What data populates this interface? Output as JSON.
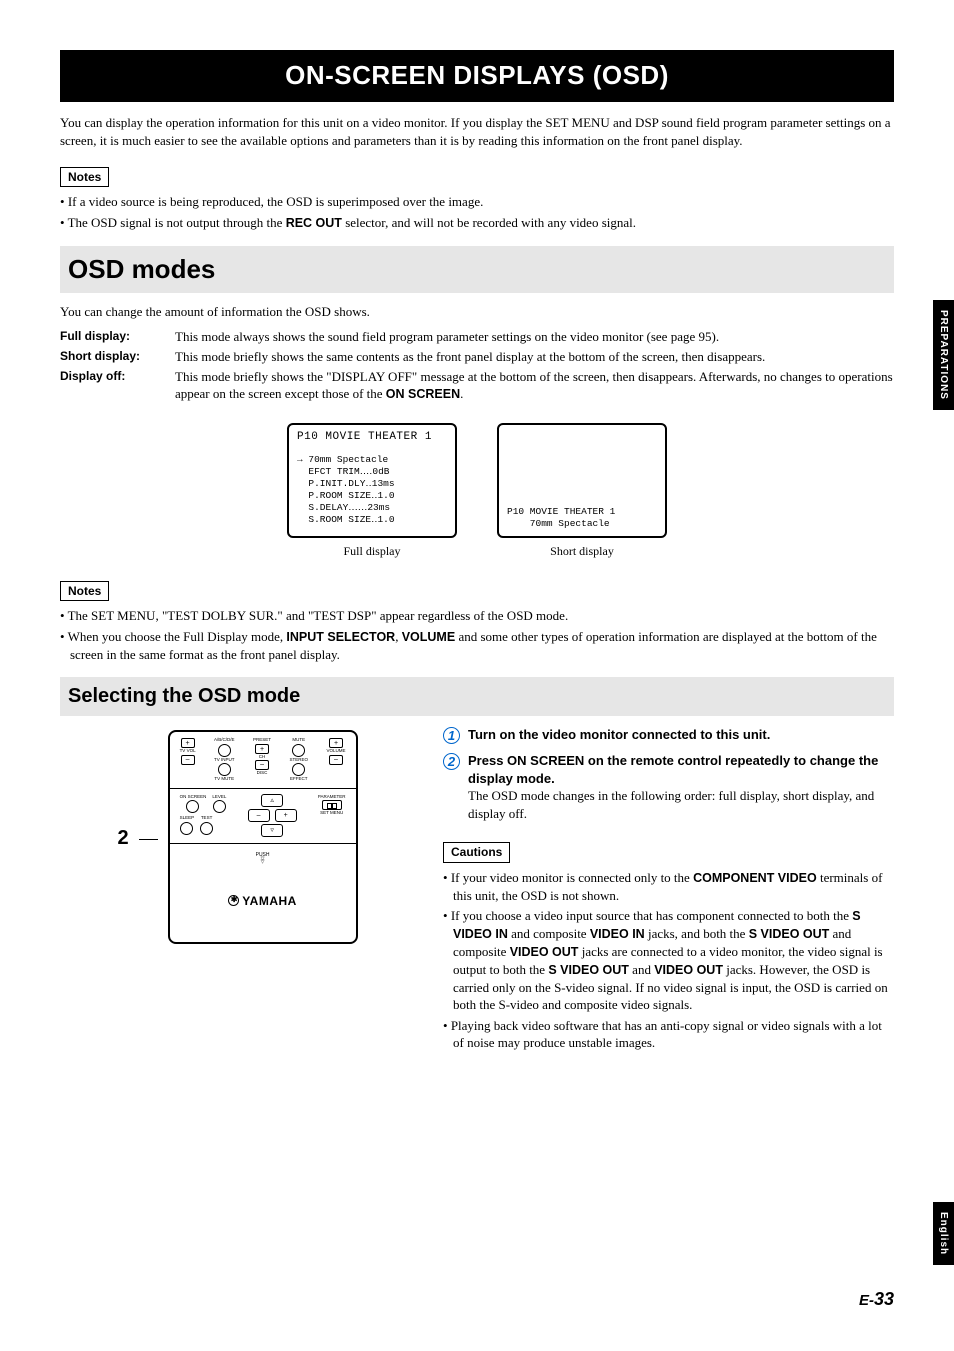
{
  "banner": "ON-SCREEN DISPLAYS (OSD)",
  "intro": "You can display the operation information for this unit on a video monitor. If you display the SET MENU and DSP sound field program parameter settings on a screen, it is much easier to see the available options and parameters than it is by reading this information on the front panel display.",
  "notes_label": "Notes",
  "cautions_label": "Cautions",
  "notes1": {
    "n1_pre": "If a video source is being reproduced, the OSD is superimposed over the image.",
    "n2_pre": "The OSD signal is not output through the ",
    "n2_bold": "REC OUT",
    "n2_post": " selector, and will not be recorded with any video signal."
  },
  "section1": {
    "heading": "OSD modes",
    "lead": "You can change the amount of information the OSD shows.",
    "defs": {
      "t1": "Full display:",
      "d1": "This mode always shows the sound field program parameter settings on the video monitor (see page 95).",
      "t2": "Short display:",
      "d2": "This mode briefly shows the same contents as the front panel display at the bottom of the screen, then disappears.",
      "t3": "Display off:",
      "d3_pre": "This mode briefly shows the \"DISPLAY OFF\" message at the bottom of the screen, then disappears. Afterwards, no changes to operations appear on the screen except those of the ",
      "d3_bold": "ON SCREEN",
      "d3_post": "."
    }
  },
  "osd": {
    "full": {
      "title": "P10 MOVIE THEATER 1",
      "body": "→ 70mm Spectacle\n  EFCT TRIM‥‥0dB\n  P.INIT.DLY‥13ms\n  P.ROOM SIZE‥1.0\n  S.DELAY‥‥‥23ms\n  S.ROOM SIZE‥1.0",
      "caption": "Full display"
    },
    "short": {
      "bottom": "P10 MOVIE THEATER 1\n    70mm Spectacle",
      "caption": "Short display"
    }
  },
  "notes2": {
    "n1": "The SET MENU, \"TEST DOLBY SUR.\" and \"TEST DSP\" appear regardless of the OSD mode.",
    "n2_pre": "When you choose the Full Display mode, ",
    "n2_b1": "INPUT SELECTOR",
    "n2_mid": ", ",
    "n2_b2": "VOLUME",
    "n2_post": " and some other types of operation information are displayed at the bottom of the screen in the same format as the front panel display."
  },
  "section2": {
    "heading": "Selecting the OSD mode",
    "ref": "2"
  },
  "remote": {
    "preset": "PRESET",
    "abcde": "A/B/C/D/E",
    "tvvol": "TV VOL",
    "tvinput": "TV INPUT",
    "tvmute": "TV MUTE",
    "ch": "CH",
    "disc": "DISC",
    "mute": "MUTE",
    "stereo": "STEREO",
    "effect": "EFFECT",
    "volume": "VOLUME",
    "onscreen": "ON SCREEN",
    "level": "LEVEL",
    "sleep": "SLEEP",
    "test": "TEST",
    "parameter": "PARAMETER",
    "setmenu": "SET MENU",
    "push": "PUSH",
    "brand": "YAMAHA",
    "plus": "+",
    "minus": "–",
    "up": "▵",
    "down": "▿"
  },
  "steps": {
    "s1_title": "Turn on the video monitor connected to this unit.",
    "s2_title": "Press ON SCREEN on the remote control repeatedly to change the display mode.",
    "s2_desc": "The OSD mode changes in the following order: full display, short display, and display off."
  },
  "cautions": {
    "c1_pre": "If your video monitor is connected only to the ",
    "c1_b1": "COMPONENT VIDEO",
    "c1_post": " terminals of this unit, the OSD is not shown.",
    "c2_pre": "If you choose a video input source that has component connected to both the ",
    "c2_b1": "S VIDEO IN",
    "c2_m1": " and composite ",
    "c2_b2": "VIDEO IN",
    "c2_m2": " jacks, and both the ",
    "c2_b3": "S VIDEO OUT",
    "c2_m3": " and composite ",
    "c2_b4": "VIDEO OUT",
    "c2_m4": " jacks are connected to a video monitor, the video signal is output to both the ",
    "c2_b5": "S VIDEO OUT",
    "c2_m5": " and ",
    "c2_b6": "VIDEO OUT",
    "c2_post": " jacks. However, the OSD is carried only on the S-video signal. If no video signal is input, the OSD is carried on both the S-video and composite video signals.",
    "c3": "Playing back video software that has an anti-copy signal or video signals with a lot of noise may produce unstable images."
  },
  "tabs": {
    "prep": "PREPARATIONS",
    "eng": "English"
  },
  "page": {
    "prefix": "E-",
    "num": "33"
  }
}
